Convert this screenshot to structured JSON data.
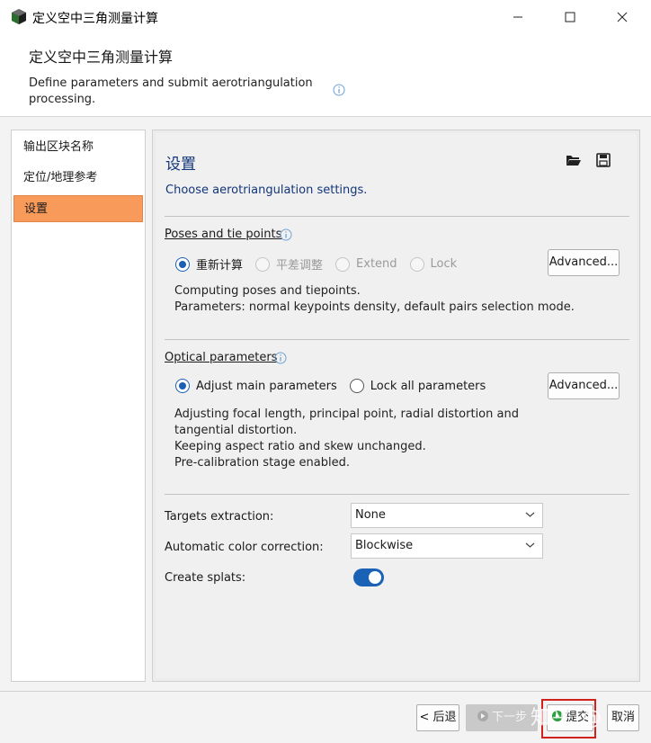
{
  "window": {
    "title": "定义空中三角测量计算",
    "icon": "cube-app-icon"
  },
  "header": {
    "title": "定义空中三角测量计算",
    "description": "Define parameters and submit aerotriangulation processing."
  },
  "sidebar": {
    "items": [
      {
        "label": "输出区块名称",
        "active": false
      },
      {
        "label": "定位/地理参考",
        "active": false
      },
      {
        "label": "设置",
        "active": true
      }
    ]
  },
  "settings": {
    "title": "设置",
    "subtitle": "Choose aerotriangulation settings."
  },
  "poses": {
    "title": "Poses and tie points",
    "options": [
      {
        "label": "重新计算",
        "checked": true,
        "enabled": true
      },
      {
        "label": "平差调整",
        "checked": false,
        "enabled": false
      },
      {
        "label": "Extend",
        "checked": false,
        "enabled": false
      },
      {
        "label": "Lock",
        "checked": false,
        "enabled": false
      }
    ],
    "advanced_label": "Advanced...",
    "description": [
      "Computing poses and tiepoints.",
      "Parameters: normal keypoints density, default pairs selection mode."
    ]
  },
  "optical": {
    "title": "Optical parameters",
    "options": [
      {
        "label": "Adjust main parameters",
        "checked": true
      },
      {
        "label": "Lock all parameters",
        "checked": false
      }
    ],
    "advanced_label": "Advanced...",
    "description": [
      "Adjusting focal length, principal point, radial distortion and",
      "tangential distortion.",
      "Keeping aspect ratio and skew unchanged.",
      "Pre-calibration stage enabled."
    ]
  },
  "form": {
    "targets_label": "Targets extraction:",
    "targets_value": "None",
    "color_label": "Automatic color correction:",
    "color_value": "Blockwise",
    "splats_label": "Create splats:",
    "splats_on": true
  },
  "footer": {
    "back_label": "< 后退",
    "next_label": "下一步",
    "submit_label": "提交",
    "cancel_label": "取消"
  },
  "watermark": "知乎 @",
  "colors": {
    "accent_blue": "#1a5fb4",
    "active_nav": "#f79a5a",
    "heading_blue": "#12357a",
    "highlight_red": "#d0211c"
  }
}
